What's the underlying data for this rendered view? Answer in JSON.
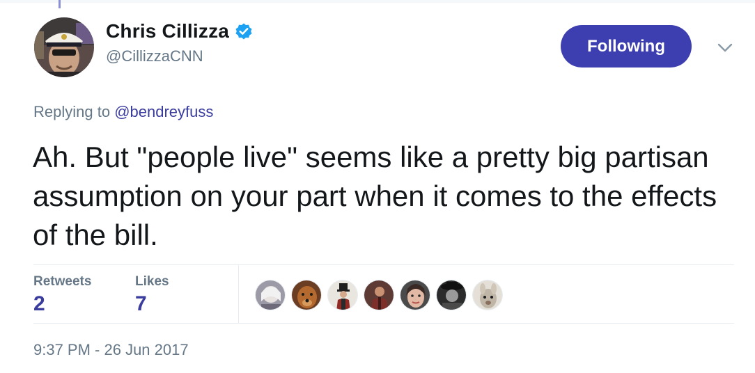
{
  "tweet": {
    "author": {
      "name": "Chris Cillizza",
      "handle": "@CillizzaCNN",
      "verified": true
    },
    "follow_button_label": "Following",
    "reply": {
      "prefix": "Replying to",
      "handle": "@bendreyfuss"
    },
    "text": "Ah. But \"people live\" seems like a pretty big partisan assumption on your part when it comes to the effects of the bill.",
    "stats": {
      "retweets_label": "Retweets",
      "retweets_count": "2",
      "likes_label": "Likes",
      "likes_count": "7"
    },
    "likers": [
      {
        "icon": "liker-avatar-icon"
      },
      {
        "icon": "liker-avatar-icon"
      },
      {
        "icon": "liker-avatar-icon"
      },
      {
        "icon": "liker-avatar-icon"
      },
      {
        "icon": "liker-avatar-icon"
      },
      {
        "icon": "liker-avatar-icon"
      },
      {
        "icon": "liker-avatar-icon"
      }
    ],
    "timestamp": "9:37 PM - 26 Jun 2017"
  },
  "colors": {
    "accent": "#3d3fb0",
    "link": "#3a3c9e",
    "muted": "#657786",
    "verified": "#1da1f2"
  }
}
